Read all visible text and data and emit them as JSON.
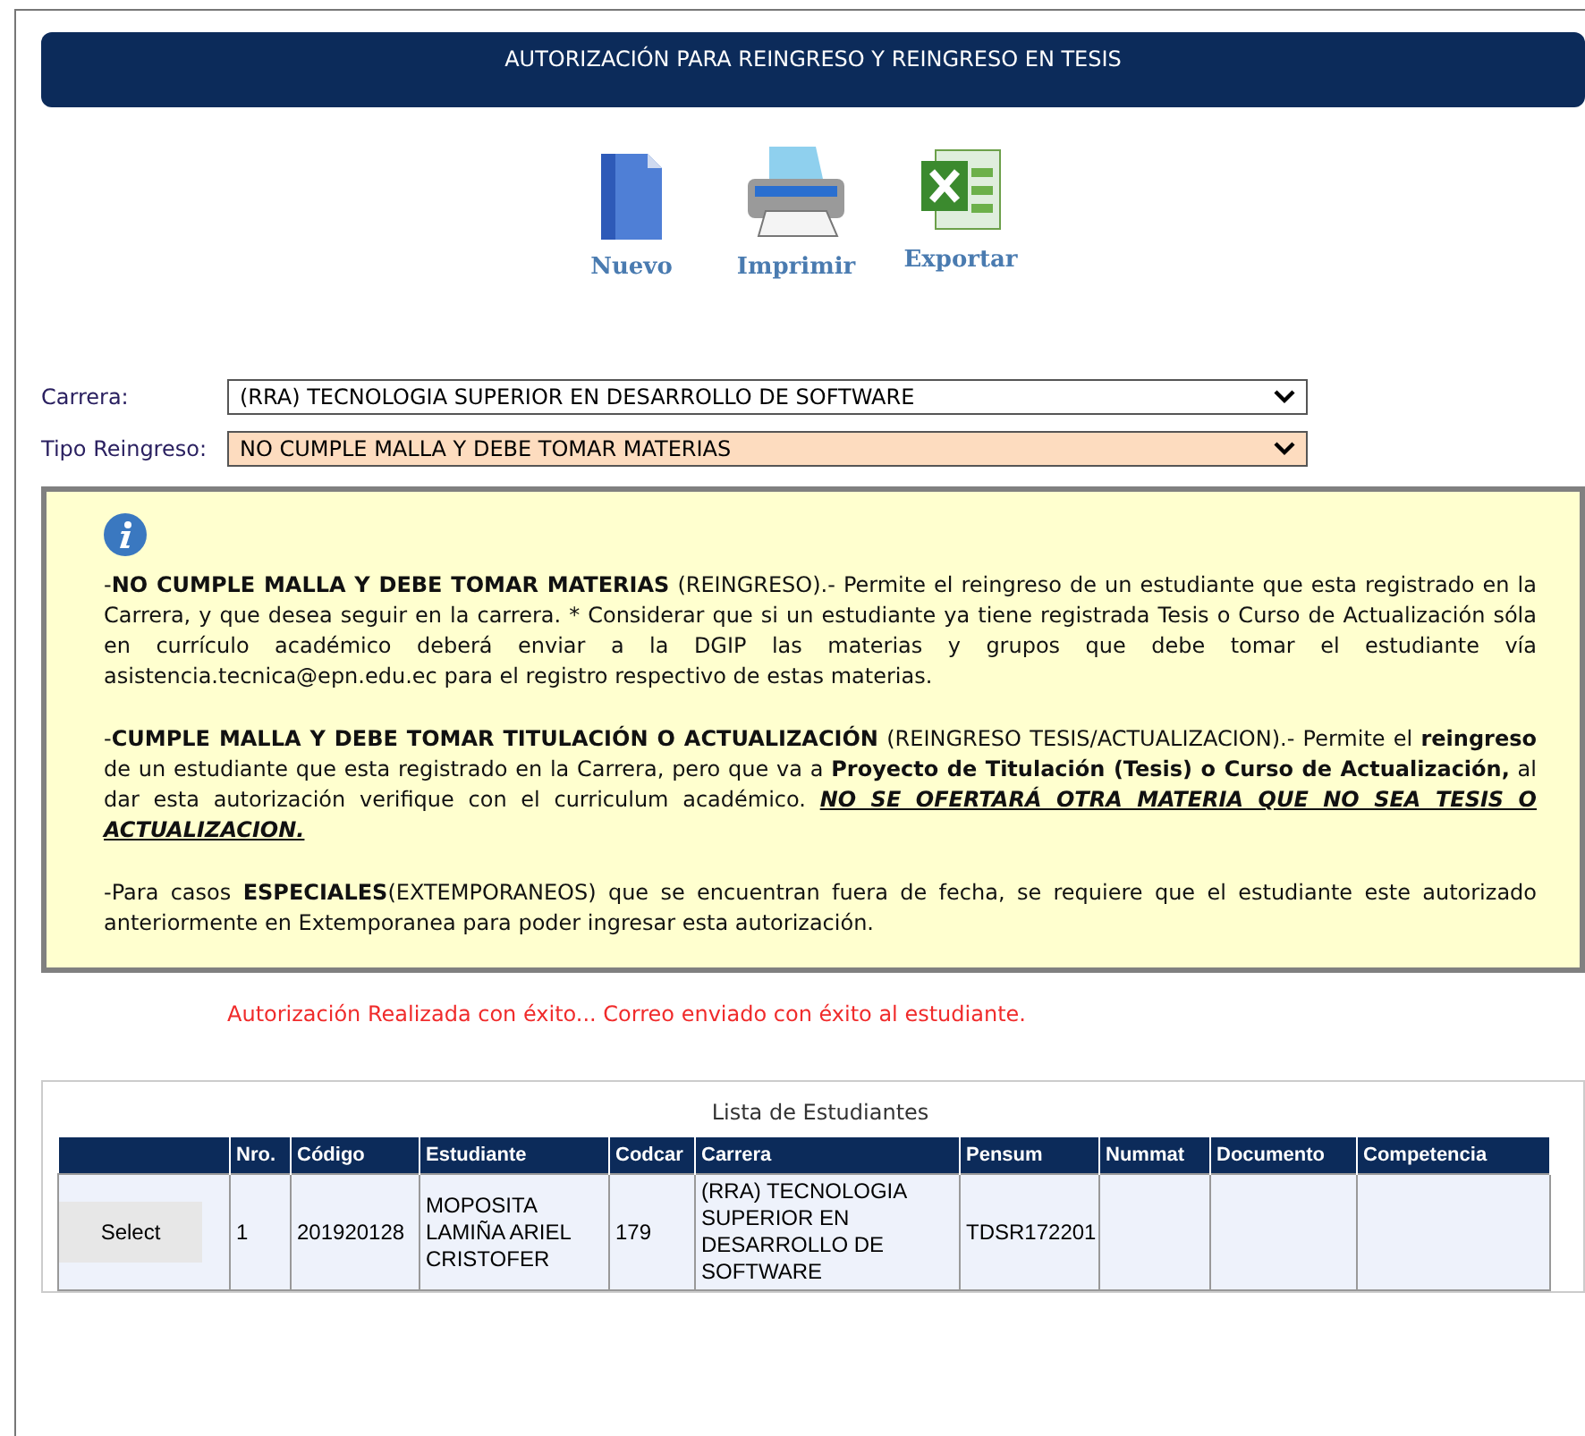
{
  "header": {
    "title": "AUTORIZACIÓN PARA REINGRESO Y REINGRESO EN TESIS"
  },
  "toolbar": [
    {
      "kind": "new",
      "label": "Nuevo"
    },
    {
      "kind": "print",
      "label": "Imprimir"
    },
    {
      "kind": "export",
      "label": "Exportar"
    }
  ],
  "form": [
    {
      "label": "Carrera:",
      "value": "(RRA) TECNOLOGIA SUPERIOR EN DESARROLLO DE SOFTWARE",
      "highlighted": false
    },
    {
      "label": "Tipo Reingreso:",
      "value": "NO CUMPLE MALLA Y DEBE TOMAR MATERIAS",
      "highlighted": true
    }
  ],
  "info": {
    "paragraphs": [
      "-**NO CUMPLE MALLA Y DEBE TOMAR MATERIAS** (REINGRESO).- Permite el reingreso de un estudiante que esta registrado en la Carrera, y que desea seguir en la  carrera. * Considerar que si un estudiante ya tiene registrada Tesis o Curso de Actualización sóla en currículo académico deberá enviar a la DGIP las materias y grupos que debe tomar el estudiante vía asistencia.tecnica@epn.edu.ec para el registro respectivo de estas materias.",
      "-**CUMPLE MALLA Y DEBE TOMAR TITULACIÓN O ACTUALIZACIÓN** (REINGRESO TESIS/ACTUALIZACION).- Permite el **reingreso** de un estudiante que esta registrado en la Carrera, pero que va a **Proyecto de Titulación (Tesis) o Curso de Actualización,** al dar esta autorización verifique con el curriculum académico. *NO SE OFERTARÁ OTRA MATERIA QUE NO SEA TESIS O ACTUALIZACION.*",
      "-Para casos **ESPECIALES**(EXTEMPORANEOS)  que se encuentran fuera de fecha,  se requiere que el estudiante este autorizado anteriormente en Extemporanea para poder ingresar esta autorización."
    ]
  },
  "message": "Autorización Realizada con éxito... Correo enviado con éxito al estudiante.",
  "table": {
    "title": "Lista de Estudiantes",
    "columns": [
      "",
      "Nro.",
      "Código",
      "Estudiante",
      "Codcar",
      "Carrera",
      "Pensum",
      "Nummat",
      "Documento",
      "Competencia"
    ],
    "rows": [
      {
        "cells": [
          "Select",
          "1",
          "201920128",
          "MOPOSITA LAMIÑA ARIEL CRISTOFER",
          "179",
          "(RRA) TECNOLOGIA SUPERIOR EN DESARROLLO DE SOFTWARE",
          "TDSR172201",
          "",
          "",
          ""
        ]
      }
    ]
  }
}
